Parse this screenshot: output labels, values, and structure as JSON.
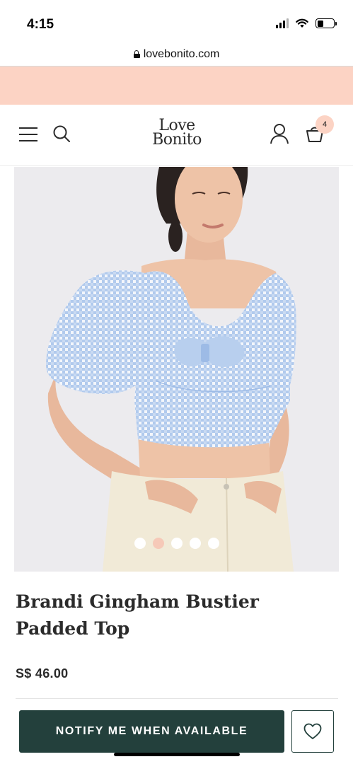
{
  "status_bar": {
    "time": "4:15",
    "icons": [
      "signal-icon",
      "wifi-icon",
      "battery-icon"
    ]
  },
  "browser": {
    "url": "lovebonito.com",
    "secure_icon": "lock-icon"
  },
  "colors": {
    "promo_band": "#fcd3c4",
    "brand_dark_green": "#23403c",
    "badge_peach": "#fcd3c4",
    "carousel_active_dot": "#f6c9b8"
  },
  "header": {
    "logo_line1": "Love",
    "logo_line2": "Bonito",
    "menu_icon": "hamburger-menu-icon",
    "search_icon": "search-icon",
    "account_icon": "user-icon",
    "cart_icon": "shopping-bag-icon",
    "cart_count": "4"
  },
  "product": {
    "title": "Brandi Gingham Bustier Padded Top",
    "price": "S$ 46.00",
    "image_count": 5,
    "active_image_index": 1
  },
  "actions": {
    "notify_label": "NOTIFY ME WHEN AVAILABLE",
    "wishlist_icon": "heart-icon"
  }
}
